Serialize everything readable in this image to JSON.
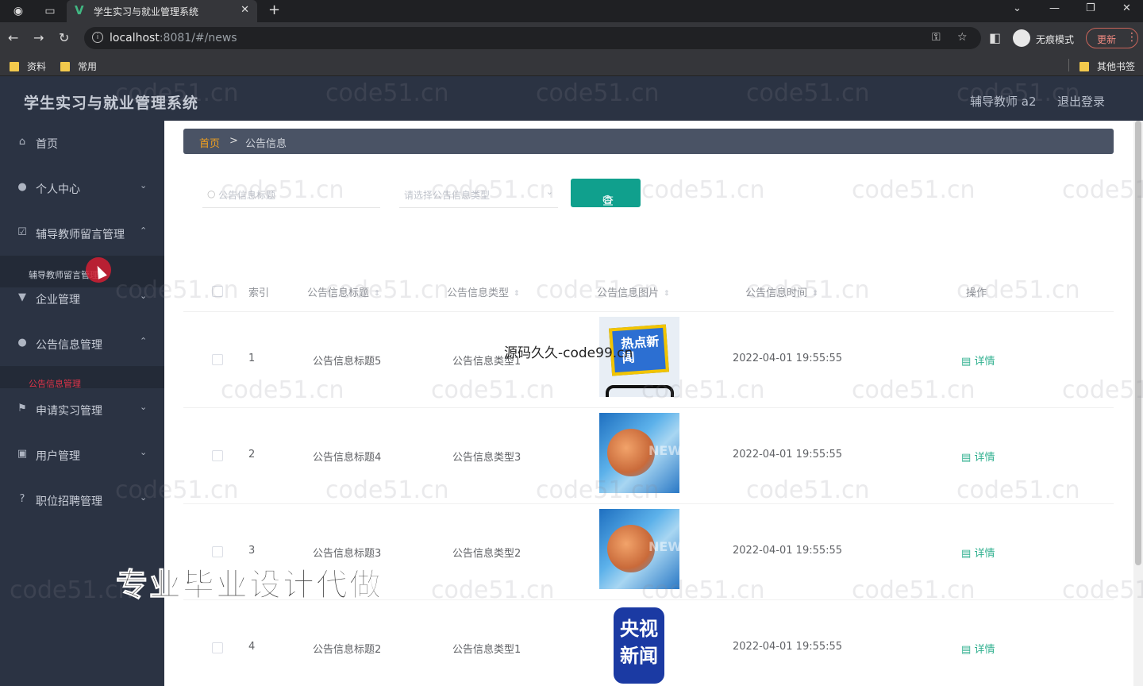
{
  "browser": {
    "tab_title": "学生实习与就业管理系统",
    "url_host": "localhost",
    "url_rest": ":8081/#/news",
    "incognito_label": "无痕模式",
    "update_label": "更新",
    "bookmarks": [
      "资料",
      "常用"
    ],
    "other_bookmarks": "其他书签"
  },
  "header": {
    "title": "学生实习与就业管理系统",
    "user": "辅导教师 a2",
    "logout": "退出登录"
  },
  "sidebar": {
    "items": [
      {
        "label": "首页"
      },
      {
        "label": "个人中心"
      },
      {
        "label": "辅导教师留言管理"
      },
      {
        "label": "辅导教师留言管理"
      },
      {
        "label": "企业管理"
      },
      {
        "label": "公告信息管理"
      },
      {
        "label": "公告信息管理"
      },
      {
        "label": "申请实习管理"
      },
      {
        "label": "用户管理"
      },
      {
        "label": "职位招聘管理"
      }
    ]
  },
  "breadcrumb": {
    "home": "首页",
    "separator": ">",
    "current": "公告信息"
  },
  "search": {
    "title_placeholder": "公告信息标题",
    "type_placeholder": "请选择公告信息类型",
    "query_button": "查询"
  },
  "table": {
    "headers": [
      "索引",
      "公告信息标题",
      "公告信息类型",
      "公告信息图片",
      "公告信息时间",
      "操作"
    ],
    "rows": [
      {
        "index": "1",
        "title": "公告信息标题5",
        "type": "公告信息类型1",
        "image": "热点新闻",
        "time": "2022-04-01 19:55:55",
        "action": "详情"
      },
      {
        "index": "2",
        "title": "公告信息标题4",
        "type": "公告信息类型3",
        "image": "NEWS",
        "time": "2022-04-01 19:55:55",
        "action": "详情"
      },
      {
        "index": "3",
        "title": "公告信息标题3",
        "type": "公告信息类型2",
        "image": "NEWS",
        "time": "2022-04-01 19:55:55",
        "action": "详情"
      },
      {
        "index": "4",
        "title": "公告信息标题2",
        "type": "公告信息类型1",
        "image": "央视新闻",
        "time": "2022-04-01 19:55:55",
        "action": "详情"
      }
    ]
  },
  "overlays": {
    "watermark": "code51.cn",
    "code99": "源码久久-code99.cn",
    "banner": "专业毕业设计代做"
  },
  "colors": {
    "accent": "#10a08d",
    "detail": "#30b08f",
    "sidebar_bg": "#2b3343",
    "breadcrumb_home": "#f0a020"
  }
}
